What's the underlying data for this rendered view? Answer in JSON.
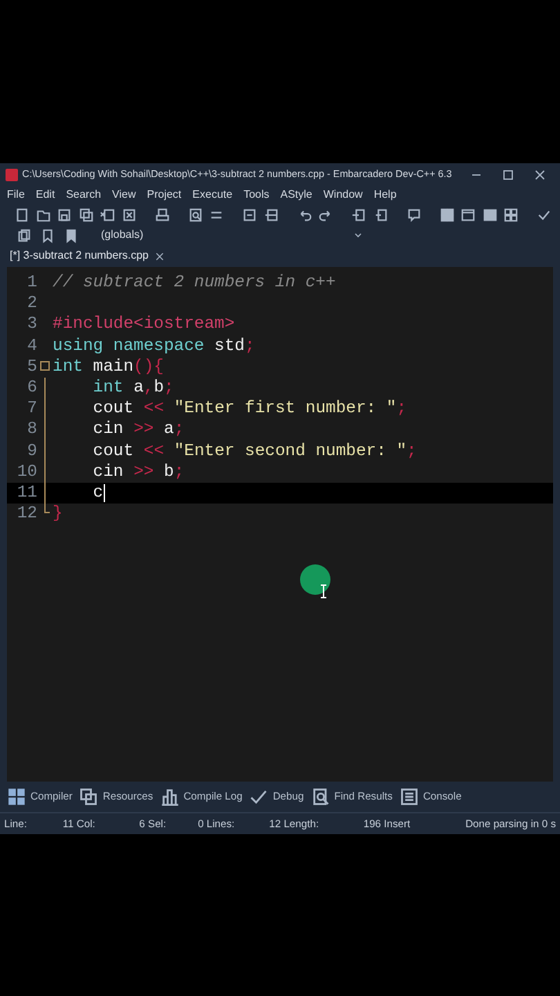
{
  "window": {
    "title": "C:\\Users\\Coding With Sohail\\Desktop\\C++\\3-subtract 2 numbers.cpp - Embarcadero Dev-C++ 6.3"
  },
  "menu": [
    "File",
    "Edit",
    "Search",
    "View",
    "Project",
    "Execute",
    "Tools",
    "AStyle",
    "Window",
    "Help"
  ],
  "scope_dropdown": {
    "value": "(globals)"
  },
  "editor_tabs": [
    {
      "label": "[*] 3-subtract 2 numbers.cpp",
      "selected": true
    }
  ],
  "code_lines": [
    {
      "number": "1",
      "indented": false,
      "current": false,
      "tokens": [
        {
          "kind": "comment",
          "text": "// subtract 2 numbers in c++"
        }
      ]
    },
    {
      "number": "2",
      "current": false
    },
    {
      "number": "3",
      "indented": false,
      "current": false,
      "tokens": [
        {
          "kind": "preprocessor",
          "text": "#include<iostream>"
        }
      ]
    },
    {
      "number": "4",
      "indented": false,
      "current": false,
      "tokens": [
        {
          "kind": "keyword",
          "text": "using namespace"
        },
        {
          "kind": "plain",
          "text": " std"
        },
        {
          "kind": "symbol",
          "text": ";"
        }
      ]
    },
    {
      "number": "5",
      "indented": false,
      "current": false,
      "tokens": [
        {
          "kind": "keyword",
          "text": "int"
        },
        {
          "kind": "plain",
          "text": " main"
        },
        {
          "kind": "symbol",
          "text": "(){"
        }
      ]
    },
    {
      "number": "6",
      "indented": true,
      "current": false,
      "tokens": [
        {
          "kind": "keyword",
          "text": "int"
        },
        {
          "kind": "plain",
          "text": " a"
        },
        {
          "kind": "symbol",
          "text": ","
        },
        {
          "kind": "plain",
          "text": "b"
        },
        {
          "kind": "symbol",
          "text": ";"
        }
      ]
    },
    {
      "number": "7",
      "indented": true,
      "current": false,
      "tokens": [
        {
          "kind": "plain",
          "text": "cout "
        },
        {
          "kind": "symbol",
          "text": "<< "
        },
        {
          "kind": "string",
          "text": "\"Enter first number: \""
        },
        {
          "kind": "symbol",
          "text": ";"
        }
      ]
    },
    {
      "number": "8",
      "indented": true,
      "current": false,
      "tokens": [
        {
          "kind": "plain",
          "text": "cin "
        },
        {
          "kind": "symbol",
          "text": ">>"
        },
        {
          "kind": "plain",
          "text": " a"
        },
        {
          "kind": "symbol",
          "text": ";"
        }
      ]
    },
    {
      "number": "9",
      "indented": true,
      "current": false,
      "tokens": [
        {
          "kind": "plain",
          "text": "cout "
        },
        {
          "kind": "symbol",
          "text": "<< "
        },
        {
          "kind": "string",
          "text": "\"Enter second number: \""
        },
        {
          "kind": "symbol",
          "text": ";"
        }
      ]
    },
    {
      "number": "10",
      "indented": true,
      "current": false,
      "tokens": [
        {
          "kind": "plain",
          "text": "cin "
        },
        {
          "kind": "symbol",
          "text": ">>"
        },
        {
          "kind": "plain",
          "text": " b"
        },
        {
          "kind": "symbol",
          "text": ";"
        }
      ]
    },
    {
      "number": "11",
      "indented": true,
      "current": true,
      "tokens": [
        {
          "kind": "plain",
          "text": "c"
        }
      ]
    },
    {
      "number": "12",
      "indented": false,
      "current": false,
      "tokens": [
        {
          "kind": "symbol",
          "text": "}"
        }
      ]
    }
  ],
  "bottom_tabs": [
    {
      "kind": "grid",
      "label": "Compiler"
    },
    {
      "kind": "stack",
      "label": "Resources"
    },
    {
      "kind": "bars",
      "label": "Compile Log"
    },
    {
      "kind": "check",
      "label": "Debug"
    },
    {
      "kind": "find",
      "label": "Find Results"
    },
    {
      "kind": "console",
      "label": "Console"
    }
  ],
  "status_bar": [
    "Line:",
    "11 Col:",
    "6 Sel:",
    "0 Lines:",
    "12 Length:",
    "196 Insert",
    "Done parsing in 0 s"
  ]
}
